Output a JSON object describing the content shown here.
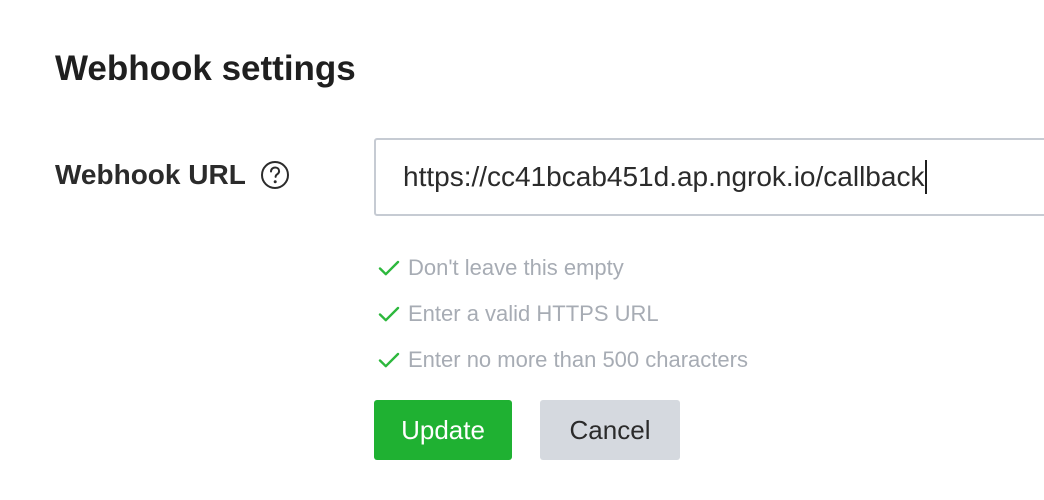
{
  "section": {
    "title": "Webhook settings"
  },
  "webhook": {
    "label": "Webhook URL",
    "help_icon": "question-circle-icon",
    "value": "https://cc41bcab451d.ap.ngrok.io/callback"
  },
  "validation": {
    "icon": "check-icon",
    "color": "#2db83d",
    "rules": [
      "Don't leave this empty",
      "Enter a valid HTTPS URL",
      "Enter no more than 500 characters"
    ]
  },
  "actions": {
    "update_label": "Update",
    "cancel_label": "Cancel",
    "update_color": "#1fb132",
    "cancel_color": "#d5d9df"
  }
}
